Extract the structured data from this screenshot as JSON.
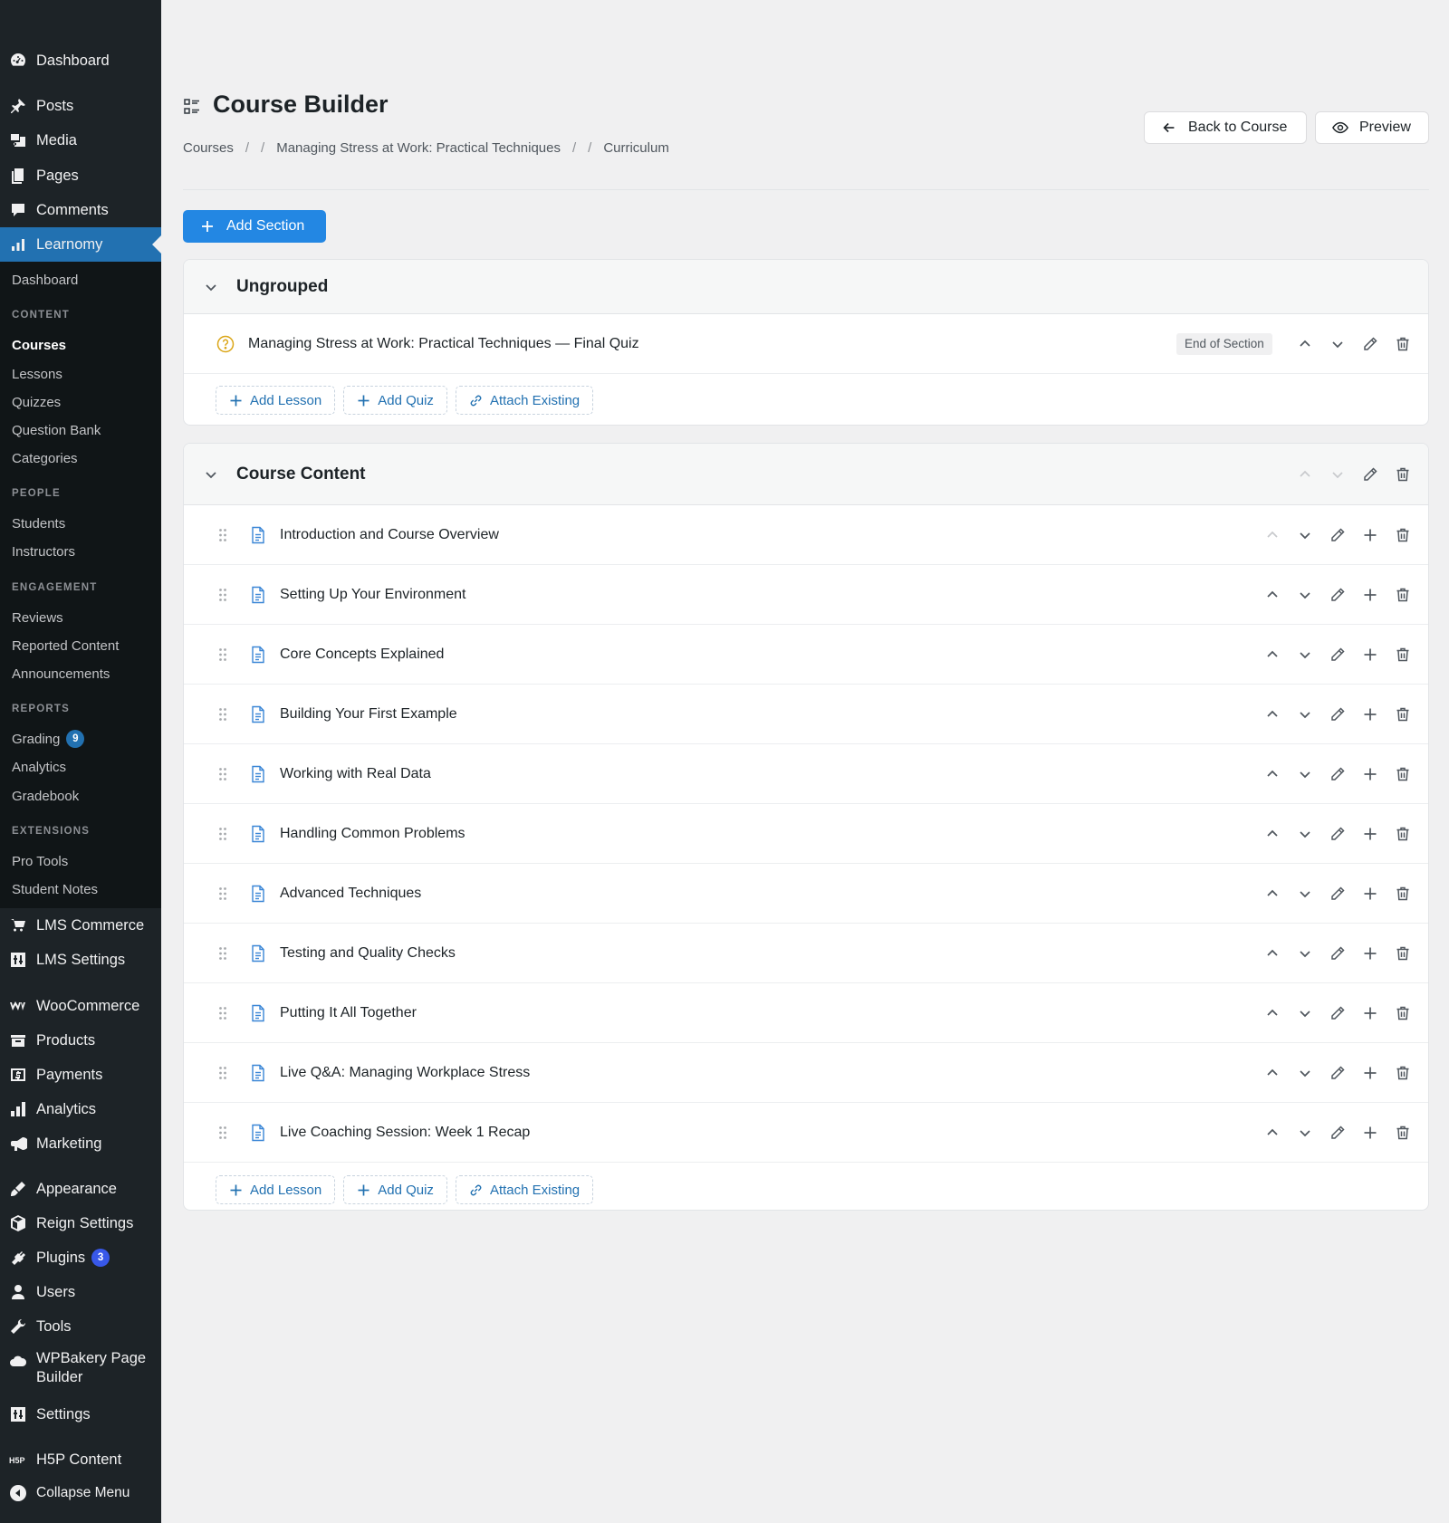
{
  "sidebar": {
    "top_items": [
      {
        "label": "Dashboard",
        "icon": "dashboard-icon"
      },
      {
        "label": "Posts",
        "icon": "pin-icon"
      },
      {
        "label": "Media",
        "icon": "media-icon"
      },
      {
        "label": "Pages",
        "icon": "pages-icon"
      },
      {
        "label": "Comments",
        "icon": "comments-icon"
      },
      {
        "label": "Learnomy",
        "icon": "chart-icon"
      }
    ],
    "submenu": {
      "dashboard": "Dashboard",
      "content_heading": "CONTENT",
      "courses": "Courses",
      "lessons": "Lessons",
      "quizzes": "Quizzes",
      "question_bank": "Question Bank",
      "categories": "Categories",
      "people_heading": "PEOPLE",
      "students": "Students",
      "instructors": "Instructors",
      "engagement_heading": "ENGAGEMENT",
      "reviews": "Reviews",
      "reported_content": "Reported Content",
      "announcements": "Announcements",
      "reports_heading": "REPORTS",
      "grading": "Grading",
      "grading_count": "9",
      "analytics": "Analytics",
      "gradebook": "Gradebook",
      "extensions_heading": "EXTENSIONS",
      "pro_tools": "Pro Tools",
      "student_notes": "Student Notes"
    },
    "bottom_items": [
      {
        "label": "LMS Commerce",
        "icon": "cart-icon"
      },
      {
        "label": "LMS Settings",
        "icon": "settings-icon"
      },
      {
        "label": "WooCommerce",
        "icon": "woo-icon"
      },
      {
        "label": "Products",
        "icon": "archive-icon"
      },
      {
        "label": "Payments",
        "icon": "dollar-icon"
      },
      {
        "label": "Analytics",
        "icon": "bar-chart-icon"
      },
      {
        "label": "Marketing",
        "icon": "megaphone-icon"
      },
      {
        "label": "Appearance",
        "icon": "brush-icon"
      },
      {
        "label": "Reign Settings",
        "icon": "cube-icon"
      },
      {
        "label": "Plugins",
        "icon": "plugin-icon",
        "badge": "3"
      },
      {
        "label": "Users",
        "icon": "user-icon"
      },
      {
        "label": "Tools",
        "icon": "wrench-icon"
      },
      {
        "label": "WPBakery Page",
        "label2": "Builder",
        "icon": "cloud-icon"
      },
      {
        "label": "Settings",
        "icon": "settings-icon"
      },
      {
        "label": "H5P Content",
        "icon": "h5p-icon"
      },
      {
        "label": "Collapse Menu",
        "icon": "collapse-icon"
      }
    ]
  },
  "header": {
    "title": "Course Builder",
    "breadcrumb": [
      "Courses",
      "Managing Stress at Work: Practical Techniques",
      "Curriculum"
    ],
    "breadcrumb_sep": "/",
    "back_button": "Back to Course",
    "preview_button": "Preview",
    "add_section": "Add Section"
  },
  "sections": [
    {
      "title": "Ungrouped",
      "items": [
        {
          "title": "Managing Stress at Work: Practical Techniques — Final Quiz",
          "type": "quiz",
          "tag": "End of Section"
        }
      ]
    },
    {
      "title": "Course Content",
      "items": [
        {
          "title": "Introduction and Course Overview"
        },
        {
          "title": "Setting Up Your Environment"
        },
        {
          "title": "Core Concepts Explained"
        },
        {
          "title": "Building Your First Example"
        },
        {
          "title": "Working with Real Data"
        },
        {
          "title": "Handling Common Problems"
        },
        {
          "title": "Advanced Techniques"
        },
        {
          "title": "Testing and Quality Checks"
        },
        {
          "title": "Putting It All Together"
        },
        {
          "title": "Live Q&A: Managing Workplace Stress"
        },
        {
          "title": "Live Coaching Session: Week 1 Recap"
        }
      ]
    }
  ],
  "footer_buttons": {
    "add_lesson": "Add Lesson",
    "add_quiz": "Add Quiz",
    "attach_existing": "Attach Existing"
  },
  "colors": {
    "accent": "#2387e3",
    "sidebar_bg": "#1d2327",
    "active_menu": "#2271b1",
    "page_bg": "#f0f0f1"
  }
}
